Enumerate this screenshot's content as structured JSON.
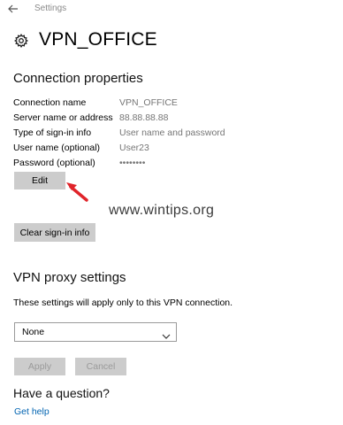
{
  "app": {
    "title": "Settings"
  },
  "page": {
    "title": "VPN_OFFICE"
  },
  "connection_properties": {
    "heading": "Connection properties",
    "rows": [
      {
        "label": "Connection name",
        "value": "VPN_OFFICE"
      },
      {
        "label": "Server name or address",
        "value": "88.88.88.88"
      },
      {
        "label": "Type of sign-in info",
        "value": "User name and password"
      },
      {
        "label": "User name (optional)",
        "value": "User23"
      },
      {
        "label": "Password (optional)",
        "value": "••••••••"
      }
    ],
    "edit_label": "Edit",
    "clear_label": "Clear sign-in info"
  },
  "watermark": "www.wintips.org",
  "proxy": {
    "heading": "VPN proxy settings",
    "description": "These settings will apply only to this VPN connection.",
    "selected_option": "None",
    "apply_label": "Apply",
    "cancel_label": "Cancel"
  },
  "help": {
    "heading": "Have a question?",
    "link": "Get help"
  },
  "colors": {
    "accent_link": "#0063b1",
    "annotation_arrow": "#e0242a",
    "button_bg": "#cccccc"
  },
  "icons": {
    "back": "back-arrow-icon",
    "settings": "gear-icon",
    "dropdown": "chevron-down-icon",
    "annotation": "red-arrow-icon"
  }
}
